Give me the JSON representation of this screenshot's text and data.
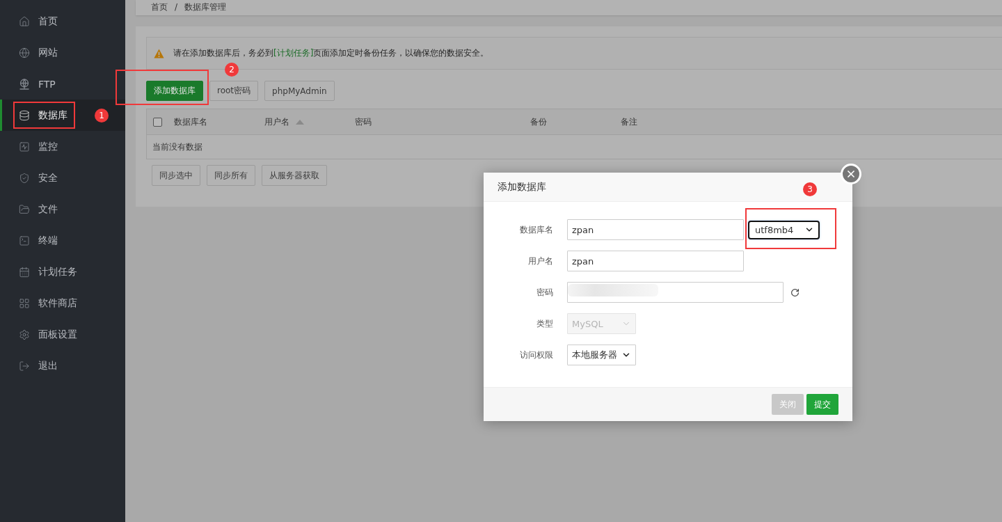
{
  "sidebar": {
    "items": [
      {
        "label": "首页",
        "selected": false
      },
      {
        "label": "网站",
        "selected": false
      },
      {
        "label": "FTP",
        "selected": false
      },
      {
        "label": "数据库",
        "selected": true
      },
      {
        "label": "监控",
        "selected": false
      },
      {
        "label": "安全",
        "selected": false
      },
      {
        "label": "文件",
        "selected": false
      },
      {
        "label": "终端",
        "selected": false
      },
      {
        "label": "计划任务",
        "selected": false
      },
      {
        "label": "软件商店",
        "selected": false
      },
      {
        "label": "面板设置",
        "selected": false
      },
      {
        "label": "退出",
        "selected": false
      }
    ],
    "callout": "1"
  },
  "breadcrumb": {
    "items": [
      "首页",
      "数据库管理"
    ],
    "separator": "/"
  },
  "alert": {
    "before": "请在添加数据库后，务必到",
    "link": "[计划任务]",
    "after": "页面添加定时备份任务，以确保您的数据安全。"
  },
  "toolbar": {
    "buttons": [
      {
        "label": "添加数据库",
        "kind": "primary"
      },
      {
        "label": "root密码",
        "kind": "default"
      },
      {
        "label": "phpMyAdmin",
        "kind": "default"
      }
    ],
    "callout": "2"
  },
  "table": {
    "select_all": {
      "checked": false
    },
    "columns": [
      {
        "label": "数据库名",
        "sorted": false
      },
      {
        "label": "用户名",
        "sorted": true
      },
      {
        "label": "密码",
        "sorted": false
      },
      {
        "label": "备份",
        "sorted": false
      },
      {
        "label": "备注",
        "sorted": false
      }
    ],
    "empty_text": "当前没有数据"
  },
  "bulk_buttons": [
    "同步选中",
    "同步所有",
    "从服务器获取"
  ],
  "dialog": {
    "title": "添加数据库",
    "callout": "3",
    "fields": [
      {
        "label": "数据库名",
        "kind": "text",
        "value": "zpan",
        "charset": {
          "value": "utf8mb4",
          "focused": true
        }
      },
      {
        "label": "用户名",
        "kind": "text",
        "value": "zpan"
      },
      {
        "label": "密码",
        "kind": "password",
        "redacted": true
      },
      {
        "label": "类型",
        "kind": "select",
        "value": "MySQL",
        "disabled": true
      },
      {
        "label": "访问权限",
        "kind": "select",
        "value": "本地服务器",
        "disabled": false
      }
    ],
    "buttons": [
      {
        "label": "关闭",
        "kind": "secondary"
      },
      {
        "label": "提交",
        "kind": "primary"
      }
    ]
  }
}
